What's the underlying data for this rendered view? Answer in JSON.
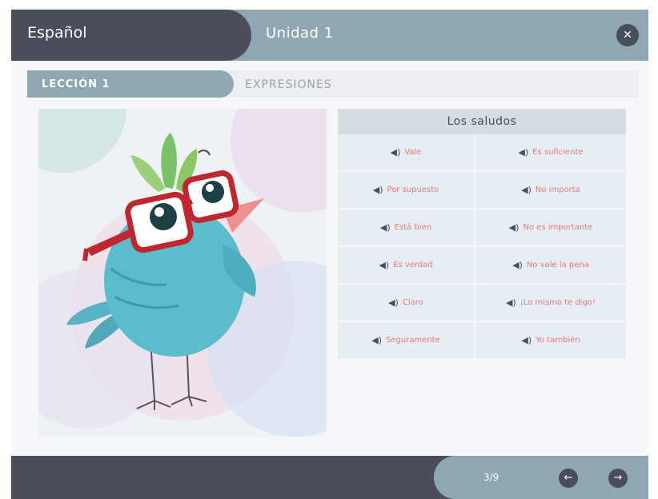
{
  "header": {
    "app_title": "Español",
    "unit_title": "Unidad 1",
    "close_icon": "close-icon"
  },
  "lesson": {
    "label": "LECCIÓN 1",
    "section": "EXPRESIONES"
  },
  "phrases": {
    "title": "Los saludos",
    "speaker_icon": "speaker-icon",
    "items": [
      "Vale",
      "Es suficiente",
      "Por supuesto",
      "No importa",
      "Está bien",
      "No es importante",
      "Es verdad",
      "No vale la pena",
      "Claro",
      "¡Lo mismo te digo!",
      "Seguramente",
      "Yo también"
    ]
  },
  "footer": {
    "page": "3/9",
    "prev_icon": "arrow-left-icon",
    "next_icon": "arrow-right-icon"
  },
  "colors": {
    "dark": "#4a4d5a",
    "accent": "#8fa7b2",
    "phrase_text": "#e87a7a",
    "cell_bg": "#e6eef4",
    "bird": "#5bbccb",
    "glasses": "#c0262d"
  }
}
